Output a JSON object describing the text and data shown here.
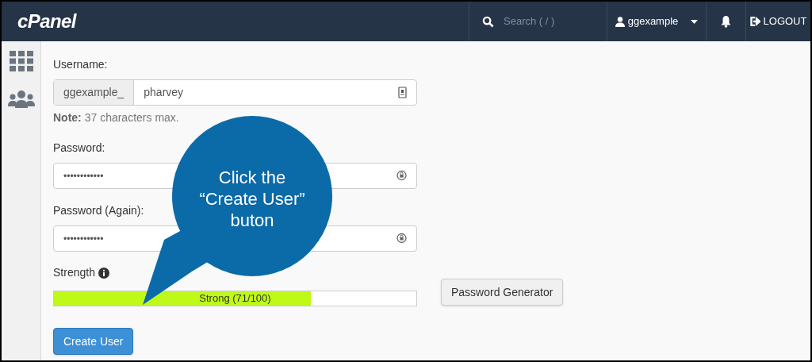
{
  "navbar": {
    "logo": "cPanel",
    "search": {
      "placeholder": "Search ( / )"
    },
    "user": "ggexample",
    "logout": "LOGOUT"
  },
  "sidebar": {
    "items": [
      {
        "kind": "grid"
      },
      {
        "kind": "users"
      }
    ]
  },
  "form": {
    "username_label": "Username:",
    "username_prefix": "ggexample_",
    "username_value": "pharvey",
    "note_bold": "Note:",
    "note": "37 characters max.",
    "password_label": "Password:",
    "password_value": "••••••••••••",
    "password_again_label": "Password (Again):",
    "password_again_value": "••••••••••••",
    "strength_label": "Strength",
    "strength": {
      "level": 0.71,
      "reading": "Strong (71/100)"
    },
    "generator_button": "Password Generator",
    "submit_button": "Create User"
  },
  "callout": {
    "text": "Click the “Create User” buton"
  }
}
